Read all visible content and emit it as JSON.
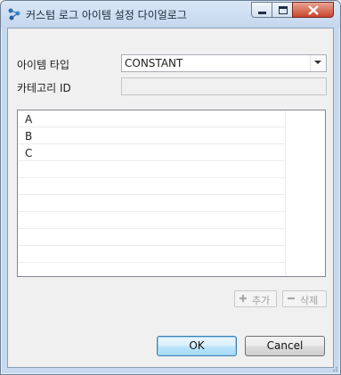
{
  "window": {
    "title": "커스텀 로그 아이템 설정 다이얼로그",
    "controls": [
      "minimize",
      "maximize",
      "close"
    ]
  },
  "form": {
    "item_type_label": "아이템 타입",
    "item_type_value": "CONSTANT",
    "category_id_label": "카테고리 ID",
    "category_id_value": ""
  },
  "table": {
    "rows": [
      "A",
      "B",
      "C"
    ]
  },
  "actions": {
    "add_label": "추가",
    "delete_label": "삭제"
  },
  "footer": {
    "ok_label": "OK",
    "cancel_label": "Cancel"
  },
  "colors": {
    "titlebar": "#c5d7ee",
    "close_button": "#c8452c",
    "ok_button_border": "#3c7fb1"
  }
}
